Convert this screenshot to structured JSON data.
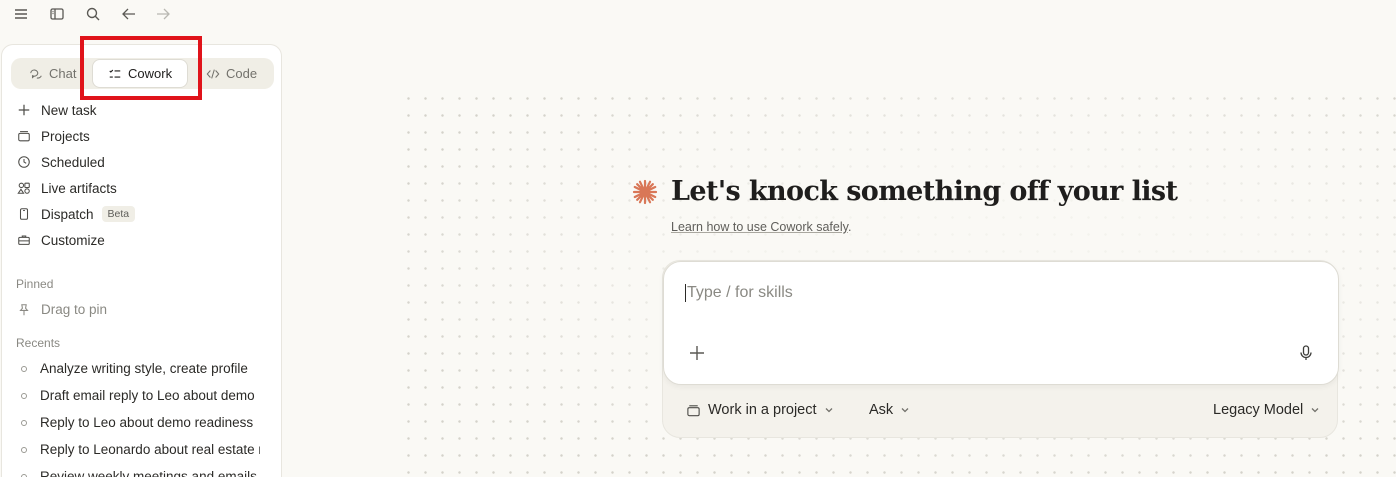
{
  "toolbar": {
    "icons": [
      "menu-icon",
      "sidebar-toggle-icon",
      "search-icon",
      "back-arrow-icon",
      "forward-arrow-icon"
    ]
  },
  "modes": {
    "chat": "Chat",
    "cowork": "Cowork",
    "code": "Code",
    "active": "Cowork"
  },
  "nav": {
    "new_task": "New task",
    "projects": "Projects",
    "scheduled": "Scheduled",
    "live_artifacts": "Live artifacts",
    "dispatch": "Dispatch",
    "dispatch_badge": "Beta",
    "customize": "Customize"
  },
  "pinned": {
    "label": "Pinned",
    "placeholder": "Drag to pin"
  },
  "recents": {
    "label": "Recents",
    "items": [
      "Analyze writing style, create profile",
      "Draft email reply to Leo about demo",
      "Reply to Leo about demo readiness",
      "Reply to Leonardo about real estate m",
      "Review weekly meetings and emails"
    ]
  },
  "main": {
    "title": "Let's knock something off your list",
    "learn_link": "Learn how to use Cowork safely",
    "learn_suffix": ".",
    "composer_placeholder": "Type / for skills",
    "project_button": "Work in a project",
    "mode_select": "Ask",
    "model_select": "Legacy Model"
  },
  "colors": {
    "accent": "#d97757",
    "highlight": "#e0131a",
    "background": "#faf9f5"
  }
}
